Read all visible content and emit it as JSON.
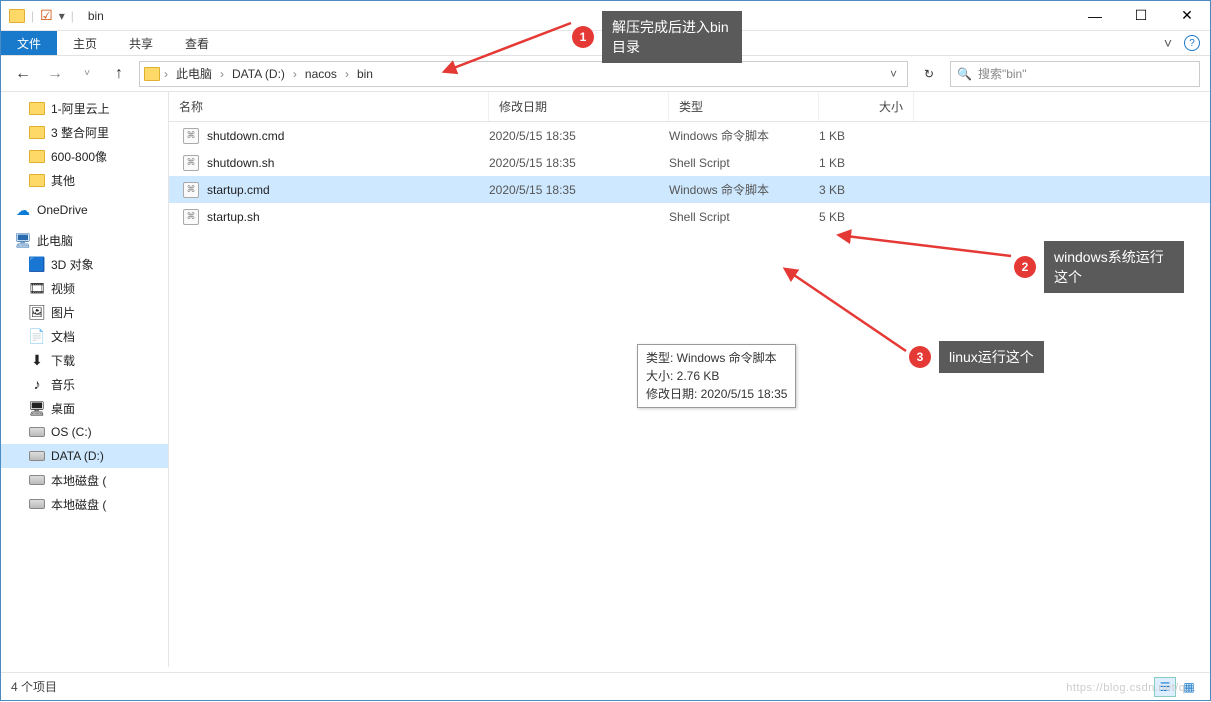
{
  "window": {
    "title": "bin"
  },
  "ribbon": {
    "file": "文件",
    "tabs": [
      "主页",
      "共享",
      "查看"
    ]
  },
  "breadcrumbs": [
    "此电脑",
    "DATA (D:)",
    "nacos",
    "bin"
  ],
  "search": {
    "placeholder": "搜索\"bin\""
  },
  "columns": {
    "name": "名称",
    "date": "修改日期",
    "type": "类型",
    "size": "大小"
  },
  "files": [
    {
      "name": "shutdown.cmd",
      "date": "2020/5/15 18:35",
      "type": "Windows 命令脚本",
      "size": "1 KB",
      "selected": false
    },
    {
      "name": "shutdown.sh",
      "date": "2020/5/15 18:35",
      "type": "Shell Script",
      "size": "1 KB",
      "selected": false
    },
    {
      "name": "startup.cmd",
      "date": "2020/5/15 18:35",
      "type": "Windows 命令脚本",
      "size": "3 KB",
      "selected": true
    },
    {
      "name": "startup.sh",
      "date": "",
      "type": "Shell Script",
      "size": "5 KB",
      "selected": false
    }
  ],
  "tooltip": {
    "line1": "类型: Windows 命令脚本",
    "line2": "大小: 2.76 KB",
    "line3": "修改日期: 2020/5/15 18:35"
  },
  "nav": {
    "quick": [
      {
        "label": "1-阿里云上",
        "icon": "folder"
      },
      {
        "label": "3 整合阿里",
        "icon": "folder"
      },
      {
        "label": "600-800像",
        "icon": "folder"
      },
      {
        "label": "其他",
        "icon": "folder"
      }
    ],
    "onedrive": "OneDrive",
    "thispc": "此电脑",
    "thispc_items": [
      {
        "label": "3D 对象",
        "icon": "3d"
      },
      {
        "label": "视频",
        "icon": "video"
      },
      {
        "label": "图片",
        "icon": "pic"
      },
      {
        "label": "文档",
        "icon": "doc"
      },
      {
        "label": "下载",
        "icon": "down"
      },
      {
        "label": "音乐",
        "icon": "music"
      },
      {
        "label": "桌面",
        "icon": "desk"
      },
      {
        "label": "OS (C:)",
        "icon": "hdd"
      },
      {
        "label": "DATA (D:)",
        "icon": "hdd",
        "selected": true
      },
      {
        "label": "本地磁盘 (",
        "icon": "hdd"
      },
      {
        "label": "本地磁盘 (",
        "icon": "hdd"
      }
    ]
  },
  "status": {
    "text": "4 个项目"
  },
  "annotations": [
    {
      "num": "1",
      "text": "解压完成后进入bin目录"
    },
    {
      "num": "2",
      "text": "windows系统运行这个"
    },
    {
      "num": "3",
      "text": "linux运行这个"
    }
  ],
  "watermark": "https://blog.csdn.net/q..."
}
